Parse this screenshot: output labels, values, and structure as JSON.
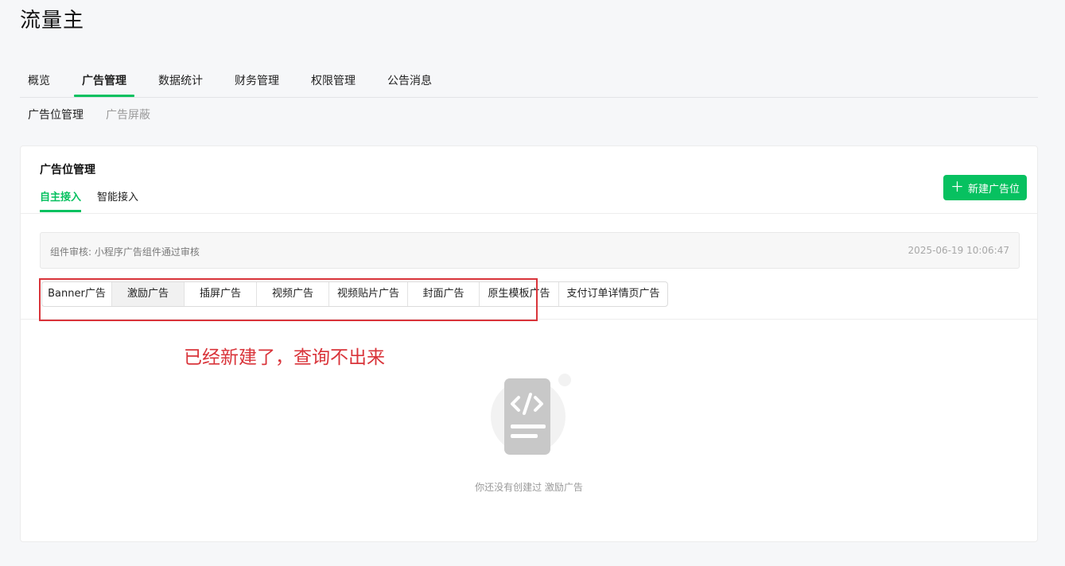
{
  "app": {
    "title": "流量主"
  },
  "main_nav": {
    "tabs": [
      {
        "label": "概览"
      },
      {
        "label": "广告管理"
      },
      {
        "label": "数据统计"
      },
      {
        "label": "财务管理"
      },
      {
        "label": "权限管理"
      },
      {
        "label": "公告消息"
      }
    ],
    "active": "广告管理"
  },
  "sub_nav": {
    "items": [
      {
        "label": "广告位管理"
      },
      {
        "label": "广告屏蔽"
      }
    ],
    "active": "广告位管理"
  },
  "card": {
    "title": "广告位管理",
    "access_tabs": [
      {
        "label": "自主接入"
      },
      {
        "label": "智能接入"
      }
    ],
    "active_access_tab": "自主接入",
    "new_button": {
      "label": "新建广告位",
      "icon": "plus-icon"
    }
  },
  "notice": {
    "text": "组件审核: 小程序广告组件通过审核",
    "time": "2025-06-19 10:06:47"
  },
  "ad_types": {
    "items": [
      {
        "label": "Banner广告"
      },
      {
        "label": "激励广告"
      },
      {
        "label": "插屏广告"
      },
      {
        "label": "视频广告"
      },
      {
        "label": "视频贴片广告"
      },
      {
        "label": "封面广告"
      },
      {
        "label": "原生模板广告"
      },
      {
        "label": "支付订单详情页广告"
      }
    ],
    "selected": "激励广告"
  },
  "annotation": {
    "text": "已经新建了，查询不出来",
    "color": "#d9343a"
  },
  "empty_state": {
    "icon": "code-document-icon",
    "text": "你还没有创建过 激励广告"
  },
  "colors": {
    "accent": "#07c160",
    "annotation": "#d9343a"
  }
}
